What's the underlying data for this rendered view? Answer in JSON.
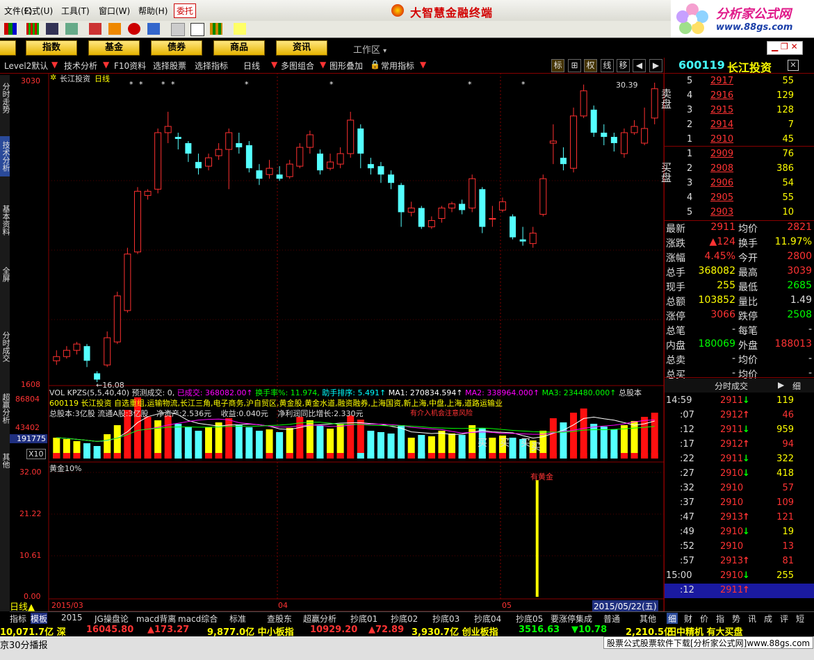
{
  "menu": [
    "帮助(H)",
    "公式(U)",
    "工具(T)",
    "窗口(W)"
  ],
  "menu_full": [
    "文件(F)",
    "公式(U)",
    "工具(T)",
    "窗口(W)",
    "帮助(H)"
  ],
  "entrust_label": "委托",
  "app_title": "大智慧金融终端",
  "watermark": {
    "title": "分析家公式网",
    "url": "www.88gs.com"
  },
  "nav": {
    "buttons": [
      "指数",
      "基金",
      "债券",
      "商品",
      "资讯"
    ],
    "workzone": "工作区"
  },
  "chart_toolbar": [
    "Level2默认",
    "技术分析",
    "F10资料",
    "选择股票",
    "选择指标",
    "日线",
    "多图组合",
    "图形叠加",
    "常用指标"
  ],
  "chart_toolbar_right": [
    "标",
    "权",
    "线",
    "移"
  ],
  "left_tabs": [
    "分时走势",
    "技术分析",
    "基本资料",
    "全屏",
    "分时成交",
    "超赢分析",
    "其他"
  ],
  "price_panel": {
    "title": "长江投资",
    "period": "日线",
    "y_top": "3030",
    "y_bottom": "1608",
    "high_label": "30.39",
    "low_label": "16.08"
  },
  "vol_panel": {
    "header_items": [
      "VOL KPZS(5,5,40,40)",
      "预测成交: 0,",
      "已成交: 368082.00↑",
      "换手率%: 11.974,",
      "助手排序: 5.491↑",
      "MA1: 270834.594↑",
      "MA2: 338964.000↑",
      "MA3: 234480.000↑",
      "总股本"
    ],
    "y_labels": [
      "86804",
      "43402"
    ],
    "cursor_value": "191775",
    "multiplier": "X10",
    "info_line1": "600119 长江投资 自选重组,运输物流,长江三角,电子商务,沪自贸区,黄金股,黄金水道,融资融券,上海国资,新上海,中盘,上海,道路运输业",
    "info_line2": [
      "总股本:3亿股",
      "流通A股:3亿股",
      "净资产:2.536元",
      "收益:0.040元",
      "净利润同比增长:2.330元"
    ],
    "annotation": "有介入机会注意风险",
    "buy_labels": [
      "买",
      "买",
      "买",
      "买"
    ]
  },
  "gold_panel": {
    "title": "黄金10%",
    "y_labels": [
      "32.00",
      "21.22",
      "10.61",
      "0.00"
    ],
    "signal_label": "有黄金"
  },
  "x_axis": {
    "labels": [
      "2015/03",
      "04",
      "05"
    ],
    "cursor_date": "2015/05/22(五)"
  },
  "bottom_tabs": {
    "left_label": "日线",
    "items": [
      "指标",
      "模板",
      "2015",
      "JG操盘论",
      "macd背离",
      "macd综合",
      "标准",
      "查股东",
      "超赢分析",
      "抄底01",
      "抄底02",
      "抄底03",
      "抄底04",
      "抄底05",
      "要涨停集成",
      "普通",
      "其他"
    ]
  },
  "right_panel": {
    "code": "600119",
    "name": "长江投资",
    "sell_label": "卖盘",
    "buy_label": "买盘",
    "sells": [
      {
        "lvl": "5",
        "price": "2917",
        "vol": "55"
      },
      {
        "lvl": "4",
        "price": "2916",
        "vol": "129"
      },
      {
        "lvl": "3",
        "price": "2915",
        "vol": "128"
      },
      {
        "lvl": "2",
        "price": "2914",
        "vol": "7"
      },
      {
        "lvl": "1",
        "price": "2910",
        "vol": "45"
      }
    ],
    "buys": [
      {
        "lvl": "1",
        "price": "2909",
        "vol": "76"
      },
      {
        "lvl": "2",
        "price": "2908",
        "vol": "386"
      },
      {
        "lvl": "3",
        "price": "2906",
        "vol": "54"
      },
      {
        "lvl": "4",
        "price": "2905",
        "vol": "55"
      },
      {
        "lvl": "5",
        "price": "2903",
        "vol": "10"
      }
    ],
    "quotes": [
      {
        "l1": "最新",
        "v1": "2911",
        "c1": "#f33",
        "l2": "均价",
        "v2": "2821",
        "c2": "#f33"
      },
      {
        "l1": "涨跌",
        "v1": "▲124",
        "c1": "#f33",
        "l2": "换手",
        "v2": "11.97%",
        "c2": "#ff0"
      },
      {
        "l1": "涨幅",
        "v1": "4.45%",
        "c1": "#f33",
        "l2": "今开",
        "v2": "2800",
        "c2": "#f33"
      },
      {
        "l1": "总手",
        "v1": "368082",
        "c1": "#ff0",
        "l2": "最高",
        "v2": "3039",
        "c2": "#f33"
      },
      {
        "l1": "现手",
        "v1": "255",
        "c1": "#ff0",
        "l2": "最低",
        "v2": "2685",
        "c2": "#0f0"
      },
      {
        "l1": "总额",
        "v1": "103852",
        "c1": "#ff0",
        "l2": "量比",
        "v2": "1.49",
        "c2": "#ddd"
      },
      {
        "l1": "涨停",
        "v1": "3066",
        "c1": "#f33",
        "l2": "跌停",
        "v2": "2508",
        "c2": "#0f0"
      },
      {
        "l1": "总笔",
        "v1": "-",
        "c1": "#ddd",
        "l2": "每笔",
        "v2": "-",
        "c2": "#ddd"
      },
      {
        "l1": "内盘",
        "v1": "180069",
        "c1": "#0f0",
        "l2": "外盘",
        "v2": "188013",
        "c2": "#f33"
      },
      {
        "l1": "总卖",
        "v1": "-",
        "c1": "#ddd",
        "l2": "均价",
        "v2": "-",
        "c2": "#ddd"
      },
      {
        "l1": "总买",
        "v1": "-",
        "c1": "#ddd",
        "l2": "均价",
        "v2": "-",
        "c2": "#ddd"
      }
    ],
    "ticks_header": "分时成交",
    "ticks_toggle": "细",
    "ticks": [
      {
        "t": "14:59",
        "p": "2911",
        "a": "↓",
        "ac": "#0f0",
        "v": "119",
        "vc": "#ff0"
      },
      {
        "t": ":07",
        "p": "2912",
        "a": "↑",
        "ac": "#f33",
        "v": "46",
        "vc": "#f33"
      },
      {
        "t": ":12",
        "p": "2911",
        "a": "↓",
        "ac": "#0f0",
        "v": "959",
        "vc": "#ff0"
      },
      {
        "t": ":17",
        "p": "2912",
        "a": "↑",
        "ac": "#f33",
        "v": "94",
        "vc": "#f33"
      },
      {
        "t": ":22",
        "p": "2911",
        "a": "↓",
        "ac": "#0f0",
        "v": "322",
        "vc": "#ff0"
      },
      {
        "t": ":27",
        "p": "2910",
        "a": "↓",
        "ac": "#0f0",
        "v": "418",
        "vc": "#ff0"
      },
      {
        "t": ":32",
        "p": "2910",
        "a": "",
        "ac": "#ddd",
        "v": "57",
        "vc": "#f33"
      },
      {
        "t": ":37",
        "p": "2910",
        "a": "",
        "ac": "#ddd",
        "v": "109",
        "vc": "#f33"
      },
      {
        "t": ":47",
        "p": "2913",
        "a": "↑",
        "ac": "#f33",
        "v": "121",
        "vc": "#f33"
      },
      {
        "t": ":49",
        "p": "2910",
        "a": "↓",
        "ac": "#0f0",
        "v": "19",
        "vc": "#ff0"
      },
      {
        "t": ":52",
        "p": "2910",
        "a": "",
        "ac": "#ddd",
        "v": "13",
        "vc": "#f33"
      },
      {
        "t": ":57",
        "p": "2913",
        "a": "↑",
        "ac": "#f33",
        "v": "81",
        "vc": "#f33"
      },
      {
        "t": "15:00",
        "p": "2910",
        "a": "↓",
        "ac": "#0f0",
        "v": "255",
        "vc": "#ff0"
      },
      {
        "t": ":12",
        "p": "2911",
        "a": "↑",
        "ac": "#f33",
        "v": "",
        "vc": "#ff0"
      }
    ],
    "bottom_tabs": [
      "细",
      "财",
      "价",
      "指",
      "势",
      "讯",
      "成",
      "评",
      "短"
    ]
  },
  "status": {
    "items": [
      {
        "text": "10,071.7亿 深",
        "color": "#ff0"
      },
      {
        "text": "16045.80",
        "color": "#f33"
      },
      {
        "text": "▲173.27",
        "color": "#f33"
      },
      {
        "text": "9,877.0亿 中小板指",
        "color": "#ff0"
      },
      {
        "text": "10929.20",
        "color": "#f33"
      },
      {
        "text": "▲72.89",
        "color": "#f33"
      },
      {
        "text": "3,930.7亿 创业板指",
        "color": "#ff0"
      },
      {
        "text": "3516.63",
        "color": "#0f0"
      },
      {
        "text": "▼10.78",
        "color": "#0f0"
      },
      {
        "text": "2,210.5亿",
        "color": "#ff0"
      },
      {
        "text": "田中精机 有大买盘",
        "color": "#ff0"
      }
    ],
    "footer_left": "京30分播报",
    "footer_right": "股票公式股票软件下载[分析家公式网]www.88gs.com"
  },
  "chart_data": {
    "type": "candlestick",
    "title": "长江投资",
    "period": "日线",
    "x_labels": [
      "2015/03",
      "04",
      "05"
    ],
    "ylim": [
      16.08,
      30.39
    ],
    "candles": [
      {
        "o": 17.1,
        "c": 17.3,
        "h": 17.6,
        "l": 16.9
      },
      {
        "o": 17.3,
        "c": 17.6,
        "h": 17.8,
        "l": 17.2
      },
      {
        "o": 17.6,
        "c": 17.9,
        "h": 18.0,
        "l": 17.4
      },
      {
        "o": 17.8,
        "c": 17.1,
        "h": 17.9,
        "l": 16.8
      },
      {
        "o": 16.5,
        "c": 16.2,
        "h": 16.6,
        "l": 16.08
      },
      {
        "o": 16.9,
        "c": 18.2,
        "h": 18.5,
        "l": 16.8
      },
      {
        "o": 18.0,
        "c": 20.2,
        "h": 20.4,
        "l": 17.9
      },
      {
        "o": 19.5,
        "c": 22.2,
        "h": 22.5,
        "l": 19.4
      },
      {
        "o": 22.3,
        "c": 25.2,
        "h": 25.4,
        "l": 22.2
      },
      {
        "o": 25.0,
        "c": 25.2,
        "h": 25.3,
        "l": 24.8
      },
      {
        "o": 25.3,
        "c": 28.0,
        "h": 28.2,
        "l": 25.1
      },
      {
        "o": 28.0,
        "c": 28.3,
        "h": 29.0,
        "l": 27.5
      },
      {
        "o": 27.8,
        "c": 27.7,
        "h": 28.0,
        "l": 27.2
      },
      {
        "o": 27.5,
        "c": 27.0,
        "h": 27.6,
        "l": 26.6
      },
      {
        "o": 26.6,
        "c": 26.3,
        "h": 27.0,
        "l": 26.0
      },
      {
        "o": 26.4,
        "c": 26.8,
        "h": 27.0,
        "l": 26.2
      },
      {
        "o": 26.9,
        "c": 27.2,
        "h": 27.5,
        "l": 26.7
      },
      {
        "o": 27.2,
        "c": 28.0,
        "h": 28.2,
        "l": 25.3
      },
      {
        "o": 27.5,
        "c": 27.3,
        "h": 28.0,
        "l": 27.0
      },
      {
        "o": 27.4,
        "c": 26.3,
        "h": 27.6,
        "l": 26.1
      },
      {
        "o": 26.2,
        "c": 25.8,
        "h": 26.5,
        "l": 25.5
      },
      {
        "o": 26.0,
        "c": 26.3,
        "h": 26.7,
        "l": 25.8
      },
      {
        "o": 26.0,
        "c": 25.8,
        "h": 26.4,
        "l": 25.7
      },
      {
        "o": 25.9,
        "c": 26.5,
        "h": 26.7,
        "l": 25.8
      },
      {
        "o": 26.4,
        "c": 27.3,
        "h": 27.5,
        "l": 26.3
      },
      {
        "o": 27.3,
        "c": 27.9,
        "h": 28.1,
        "l": 27.0
      },
      {
        "o": 27.0,
        "c": 26.2,
        "h": 27.2,
        "l": 26.0
      },
      {
        "o": 26.3,
        "c": 26.6,
        "h": 27.0,
        "l": 26.2
      },
      {
        "o": 26.5,
        "c": 27.0,
        "h": 27.3,
        "l": 26.3
      },
      {
        "o": 27.0,
        "c": 28.6,
        "h": 29.0,
        "l": 26.8
      },
      {
        "o": 28.2,
        "c": 27.0,
        "h": 28.4,
        "l": 26.3
      },
      {
        "o": 26.5,
        "c": 26.3,
        "h": 26.8,
        "l": 26.0
      },
      {
        "o": 26.4,
        "c": 26.0,
        "h": 26.6,
        "l": 25.6
      },
      {
        "o": 26.0,
        "c": 25.6,
        "h": 26.2,
        "l": 25.3
      },
      {
        "o": 25.5,
        "c": 24.2,
        "h": 25.6,
        "l": 23.5
      },
      {
        "o": 24.2,
        "c": 24.4,
        "h": 24.7,
        "l": 24.0
      },
      {
        "o": 24.4,
        "c": 23.5,
        "h": 24.5,
        "l": 23.4
      },
      {
        "o": 23.5,
        "c": 23.8,
        "h": 24.0,
        "l": 23.4
      },
      {
        "o": 23.9,
        "c": 24.4,
        "h": 24.5,
        "l": 23.7
      },
      {
        "o": 24.4,
        "c": 24.6,
        "h": 24.7,
        "l": 24.2
      },
      {
        "o": 24.6,
        "c": 24.3,
        "h": 24.8,
        "l": 24.1
      },
      {
        "o": 24.4,
        "c": 25.8,
        "h": 26.0,
        "l": 24.2
      },
      {
        "o": 25.3,
        "c": 23.5,
        "h": 25.4,
        "l": 23.2
      },
      {
        "o": 23.9,
        "c": 23.9,
        "h": 24.5,
        "l": 23.5
      },
      {
        "o": 24.3,
        "c": 24.7,
        "h": 24.9,
        "l": 24.2
      },
      {
        "o": 24.0,
        "c": 23.0,
        "h": 24.1,
        "l": 22.9
      },
      {
        "o": 22.9,
        "c": 22.8,
        "h": 23.5,
        "l": 22.6
      },
      {
        "o": 22.7,
        "c": 23.2,
        "h": 23.5,
        "l": 22.5
      },
      {
        "o": 24.1,
        "c": 25.8,
        "h": 26.0,
        "l": 24.0
      },
      {
        "o": 27.5,
        "c": 27.6,
        "h": 28.4,
        "l": 26.5
      },
      {
        "o": 26.8,
        "c": 26.5,
        "h": 27.3,
        "l": 26.2
      },
      {
        "o": 26.3,
        "c": 28.8,
        "h": 29.2,
        "l": 26.1
      },
      {
        "o": 28.8,
        "c": 30.0,
        "h": 30.3,
        "l": 28.7
      },
      {
        "o": 29.1,
        "c": 28.0,
        "h": 29.3,
        "l": 27.8
      },
      {
        "o": 28.0,
        "c": 27.8,
        "h": 28.4,
        "l": 27.4
      },
      {
        "o": 27.8,
        "c": 27.5,
        "h": 28.0,
        "l": 27.1
      },
      {
        "o": 27.0,
        "c": 28.0,
        "h": 28.2,
        "l": 26.8
      },
      {
        "o": 28.0,
        "c": 28.3,
        "h": 28.6,
        "l": 27.9
      },
      {
        "o": 27.5,
        "c": 28.2,
        "h": 29.2,
        "l": 27.4
      },
      {
        "o": 28.7,
        "c": 30.1,
        "h": 30.39,
        "l": 28.4
      }
    ],
    "volume": [
      30,
      28,
      25,
      22,
      18,
      35,
      48,
      70,
      88,
      60,
      55,
      62,
      50,
      46,
      40,
      45,
      52,
      58,
      48,
      45,
      40,
      42,
      38,
      44,
      60,
      55,
      47,
      43,
      50,
      62,
      56,
      40,
      38,
      36,
      48,
      30,
      34,
      32,
      40,
      36,
      34,
      48,
      44,
      30,
      33,
      30,
      28,
      26,
      40,
      58,
      52,
      66,
      72,
      50,
      46,
      42,
      48,
      54,
      60,
      66
    ],
    "vol_ylim": [
      0,
      86804
    ],
    "gold_signal": {
      "index": 47,
      "value": 30.0
    },
    "gold_ylim": [
      0,
      32
    ]
  }
}
